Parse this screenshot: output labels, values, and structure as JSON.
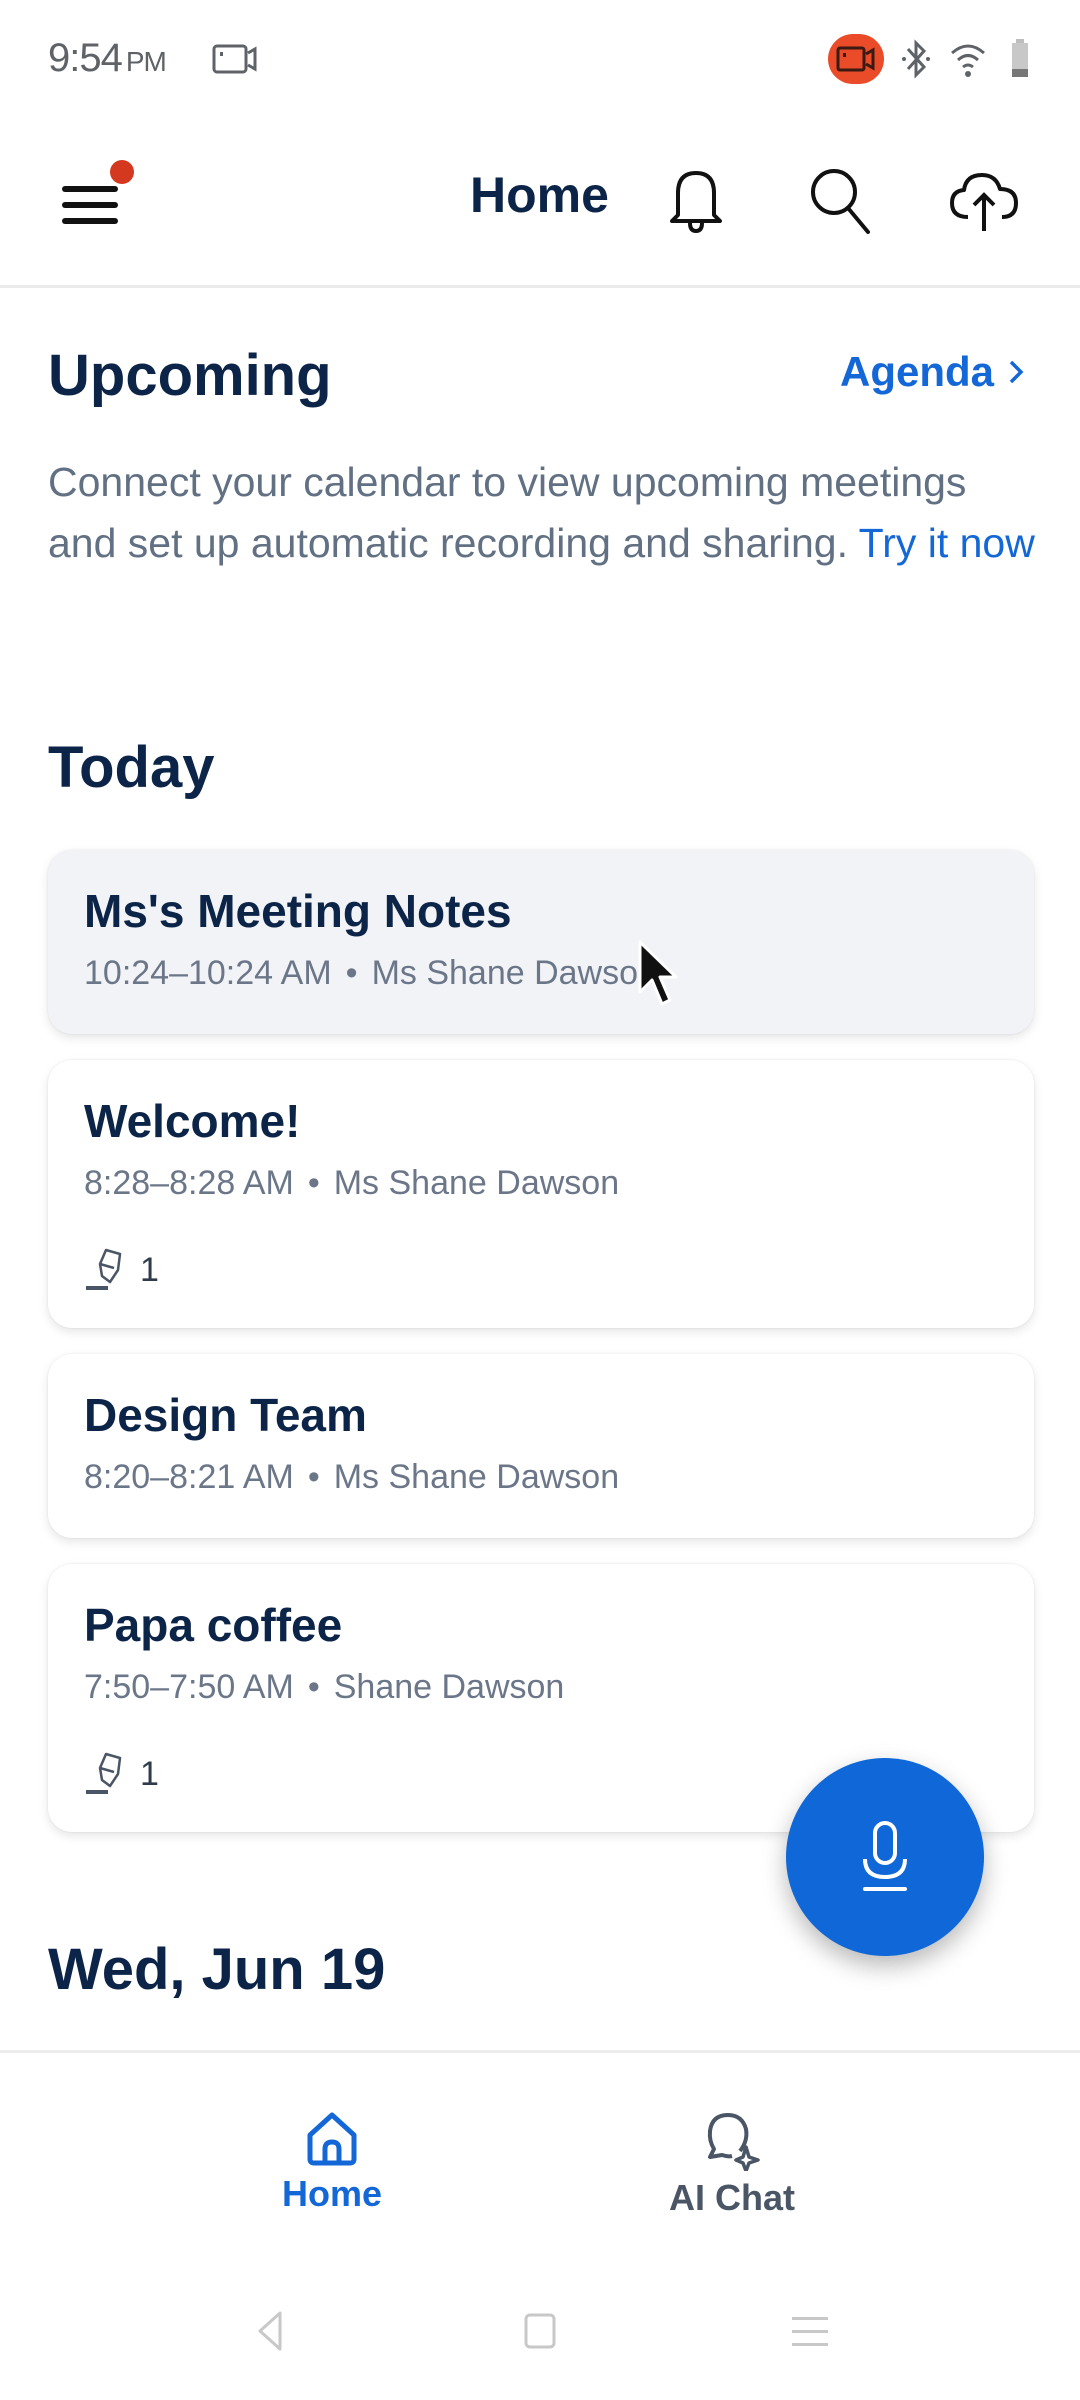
{
  "status_bar": {
    "time": "9:54",
    "ampm": "PM",
    "icons": [
      "screen-record-icon",
      "recording-active-icon",
      "bluetooth-icon",
      "wifi-icon",
      "battery-icon"
    ]
  },
  "header": {
    "title": "Home",
    "has_notification_dot": true,
    "actions": [
      "bell-icon",
      "search-icon",
      "cloud-upload-icon"
    ]
  },
  "upcoming": {
    "title": "Upcoming",
    "agenda_label": "Agenda",
    "message": "Connect your calendar to view upcoming meetings and set up automatic recording and sharing.",
    "cta_label": "Try it now"
  },
  "today": {
    "title": "Today",
    "meetings": [
      {
        "title": "Ms's Meeting Notes",
        "time": "10:24–10:24 AM",
        "owner": "Ms Shane Dawson",
        "highlights": null,
        "selected": true
      },
      {
        "title": "Welcome!",
        "time": "8:28–8:28 AM",
        "owner": "Ms Shane Dawson",
        "highlights": "1",
        "selected": false
      },
      {
        "title": "Design Team",
        "time": "8:20–8:21 AM",
        "owner": "Ms Shane Dawson",
        "highlights": null,
        "selected": false
      },
      {
        "title": "Papa coffee",
        "time": "7:50–7:50 AM",
        "owner": "Shane Dawson",
        "highlights": "1",
        "selected": false
      }
    ]
  },
  "next_section": {
    "title": "Wed, Jun 19"
  },
  "fab": {
    "icon": "microphone-icon"
  },
  "bottom_nav": {
    "items": [
      {
        "label": "Home",
        "icon": "home-icon",
        "active": true
      },
      {
        "label": "AI Chat",
        "icon": "ai-chat-icon",
        "active": false
      }
    ]
  },
  "colors": {
    "primary": "#1467d6",
    "fab": "#0f67d8",
    "title": "#0b2447",
    "muted": "#627083",
    "notification": "#d4391f",
    "recording": "#ea4c2a"
  }
}
